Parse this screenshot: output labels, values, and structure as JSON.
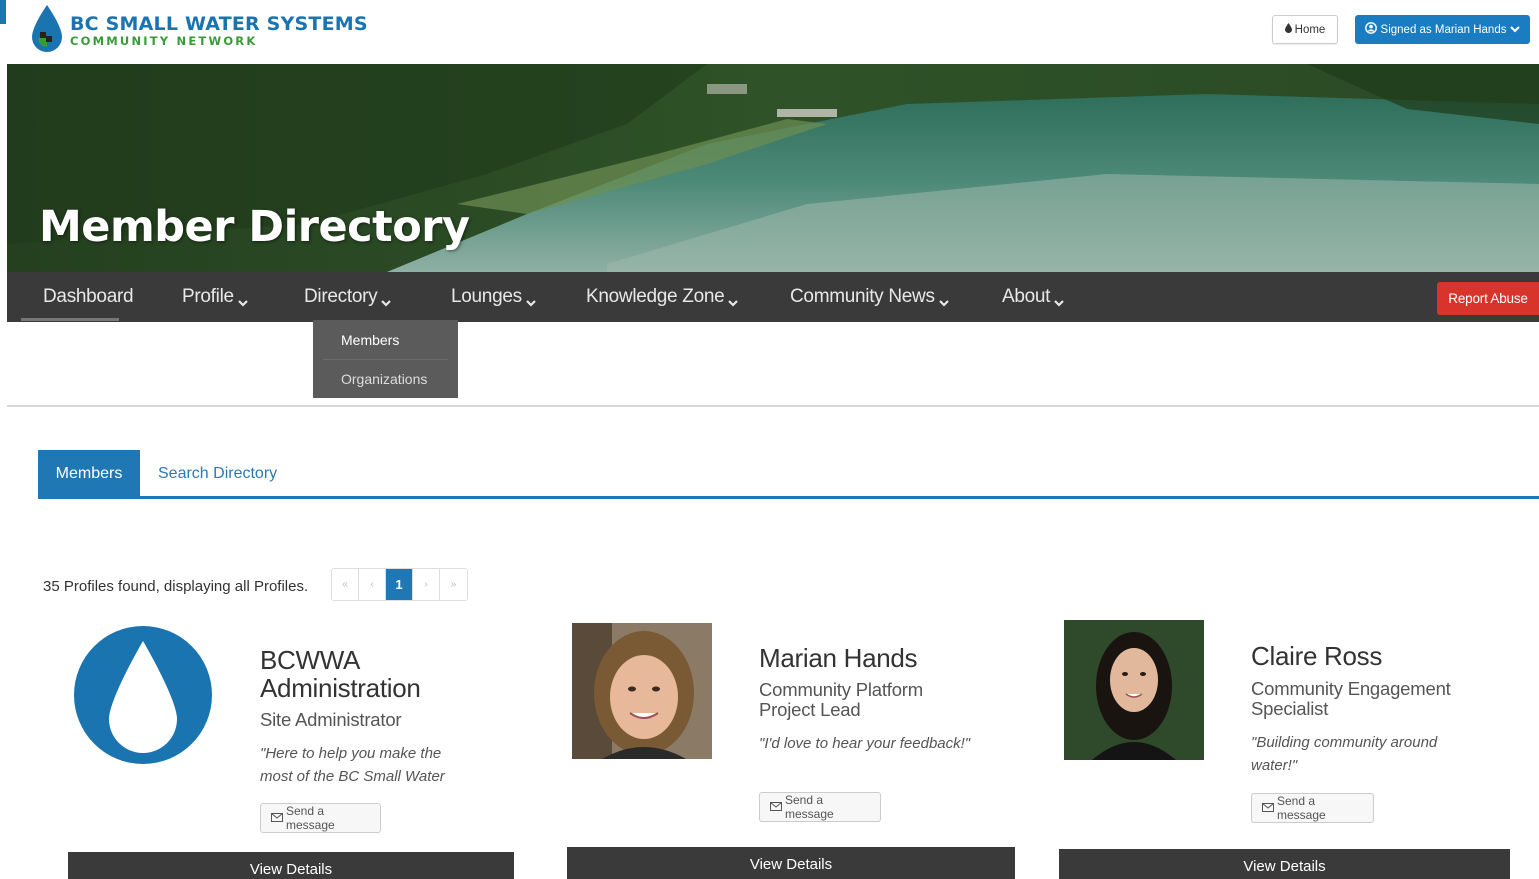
{
  "brand": {
    "title": "BC SMALL WATER SYSTEMS",
    "subtitle": "COMMUNITY NETWORK"
  },
  "header": {
    "home_label": "Home",
    "signed_in_label": "Signed as Marian Hands"
  },
  "hero": {
    "title": "Member Directory"
  },
  "nav": {
    "items": [
      {
        "label": "Dashboard"
      },
      {
        "label": "Profile"
      },
      {
        "label": "Directory"
      },
      {
        "label": "Lounges"
      },
      {
        "label": "Knowledge Zone"
      },
      {
        "label": "Community News"
      },
      {
        "label": "About"
      }
    ],
    "report_label": "Report Abuse",
    "directory_dropdown": [
      "Members",
      "Organizations"
    ]
  },
  "tabs": {
    "active": "Members",
    "other": "Search Directory"
  },
  "results": {
    "count_text": "35 Profiles found, displaying all Profiles.",
    "current_page": "1"
  },
  "members": [
    {
      "name": "BCWWA Administration",
      "name_line1": "BCWWA",
      "name_line2": "Administration",
      "role": "Site Administrator",
      "quote_line1": "\"Here to help you make the",
      "quote_line2": "most of the BC Small Water",
      "message_label": "Send a message",
      "details_label": "View Details"
    },
    {
      "name": "Marian Hands",
      "role_line1": "Community Platform",
      "role_line2": "Project Lead",
      "quote": "\"I'd love to hear your feedback!\"",
      "message_label": "Send a message",
      "details_label": "View Details"
    },
    {
      "name": "Claire Ross",
      "role_line1": "Community Engagement",
      "role_line2": "Specialist",
      "quote_line1": "\"Building community around",
      "quote_line2": "water!\"",
      "message_label": "Send a message",
      "details_label": "View Details"
    }
  ],
  "colors": {
    "brand_blue": "#1a74b0",
    "brand_green": "#3a9a3a",
    "nav_bg": "#3a3a3a",
    "report_red": "#d9342b",
    "tab_blue": "#1f78b4"
  }
}
